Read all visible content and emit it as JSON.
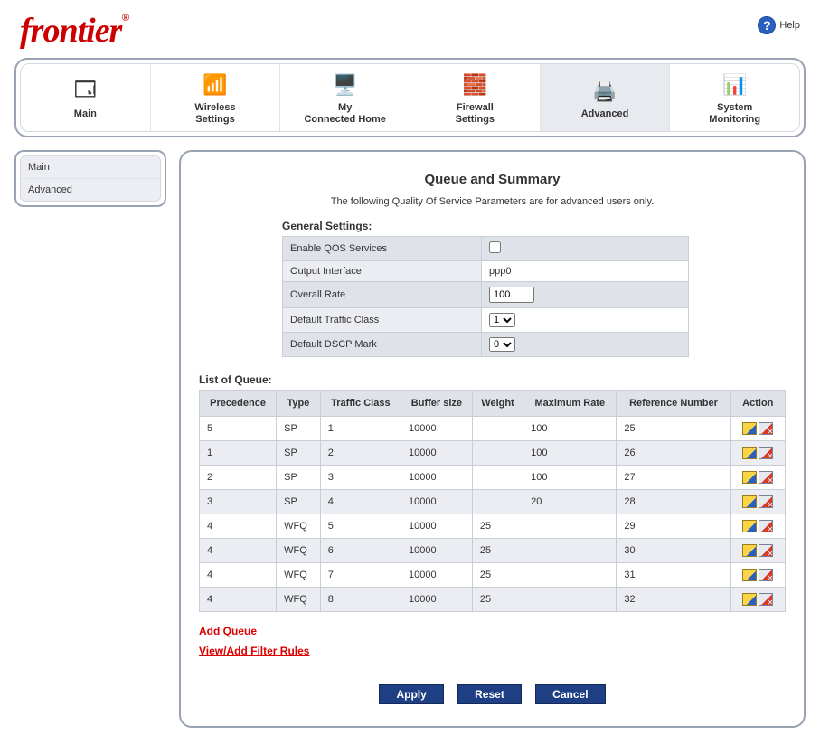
{
  "brand": "frontier",
  "help_label": "Help",
  "nav": [
    {
      "label": "Main",
      "icon": "🗔"
    },
    {
      "label": "Wireless Settings",
      "icon": "📶"
    },
    {
      "label": "My Connected Home",
      "icon": "🖥️"
    },
    {
      "label": "Firewall Settings",
      "icon": "🧱"
    },
    {
      "label": "Advanced",
      "icon": "🖨️",
      "active": true
    },
    {
      "label": "System Monitoring",
      "icon": "📊"
    }
  ],
  "side": [
    {
      "label": "Main"
    },
    {
      "label": "Advanced"
    }
  ],
  "page": {
    "title": "Queue and Summary",
    "subtitle": "The following Quality Of Service Parameters are for advanced users only."
  },
  "general": {
    "heading": "General Settings:",
    "rows": {
      "enable_label": "Enable QOS Services",
      "enable_checked": false,
      "output_label": "Output Interface",
      "output_value": "ppp0",
      "rate_label": "Overall Rate",
      "rate_value": "100",
      "dtc_label": "Default Traffic Class",
      "dtc_value": "1",
      "dscp_label": "Default DSCP Mark",
      "dscp_value": "0"
    }
  },
  "queue": {
    "heading": "List of Queue:",
    "headers": [
      "Precedence",
      "Type",
      "Traffic Class",
      "Buffer size",
      "Weight",
      "Maximum Rate",
      "Reference Number",
      "Action"
    ],
    "rows": [
      {
        "precedence": "5",
        "type": "SP",
        "tc": "1",
        "buf": "10000",
        "weight": "",
        "max": "100",
        "ref": "25"
      },
      {
        "precedence": "1",
        "type": "SP",
        "tc": "2",
        "buf": "10000",
        "weight": "",
        "max": "100",
        "ref": "26"
      },
      {
        "precedence": "2",
        "type": "SP",
        "tc": "3",
        "buf": "10000",
        "weight": "",
        "max": "100",
        "ref": "27"
      },
      {
        "precedence": "3",
        "type": "SP",
        "tc": "4",
        "buf": "10000",
        "weight": "",
        "max": "20",
        "ref": "28"
      },
      {
        "precedence": "4",
        "type": "WFQ",
        "tc": "5",
        "buf": "10000",
        "weight": "25",
        "max": "",
        "ref": "29"
      },
      {
        "precedence": "4",
        "type": "WFQ",
        "tc": "6",
        "buf": "10000",
        "weight": "25",
        "max": "",
        "ref": "30"
      },
      {
        "precedence": "4",
        "type": "WFQ",
        "tc": "7",
        "buf": "10000",
        "weight": "25",
        "max": "",
        "ref": "31"
      },
      {
        "precedence": "4",
        "type": "WFQ",
        "tc": "8",
        "buf": "10000",
        "weight": "25",
        "max": "",
        "ref": "32"
      }
    ]
  },
  "links": {
    "add_queue": "Add Queue",
    "view_filter": "View/Add Filter Rules"
  },
  "buttons": {
    "apply": "Apply",
    "reset": "Reset",
    "cancel": "Cancel"
  }
}
